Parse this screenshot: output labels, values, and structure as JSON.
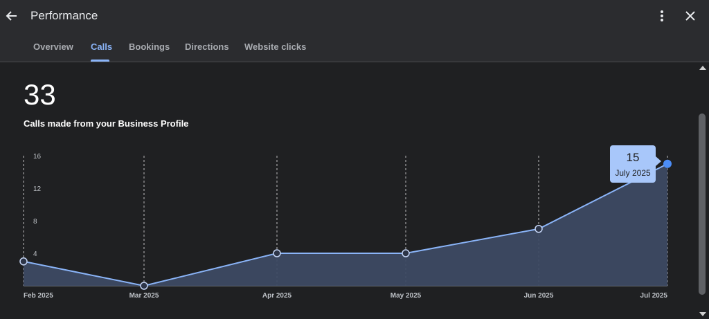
{
  "header": {
    "title": "Performance",
    "back_icon": "arrow-left-icon",
    "more_icon": "more-vertical-icon",
    "close_icon": "close-icon"
  },
  "tabs": [
    {
      "label": "Overview",
      "active": false
    },
    {
      "label": "Calls",
      "active": true
    },
    {
      "label": "Bookings",
      "active": false
    },
    {
      "label": "Directions",
      "active": false
    },
    {
      "label": "Website clicks",
      "active": false
    }
  ],
  "summary": {
    "total": "33",
    "caption": "Calls made from your Business Profile"
  },
  "tooltip": {
    "value": "15",
    "label": "July 2025"
  },
  "colors": {
    "accent": "#8ab4f8",
    "tooltip_bg": "#a8c7fa",
    "area_fill": "#3d4a63",
    "active_point": "#4c8df6"
  },
  "chart_data": {
    "type": "area",
    "categories": [
      "Feb 2025",
      "Mar 2025",
      "Apr 2025",
      "May 2025",
      "Jun 2025",
      "Jul 2025"
    ],
    "values": [
      3,
      0,
      4,
      4,
      7,
      15
    ],
    "yticks": [
      "16",
      "12",
      "8",
      "4"
    ],
    "ylim": [
      0,
      16
    ],
    "grid": "vertical-dashed",
    "highlighted_index": 5
  }
}
